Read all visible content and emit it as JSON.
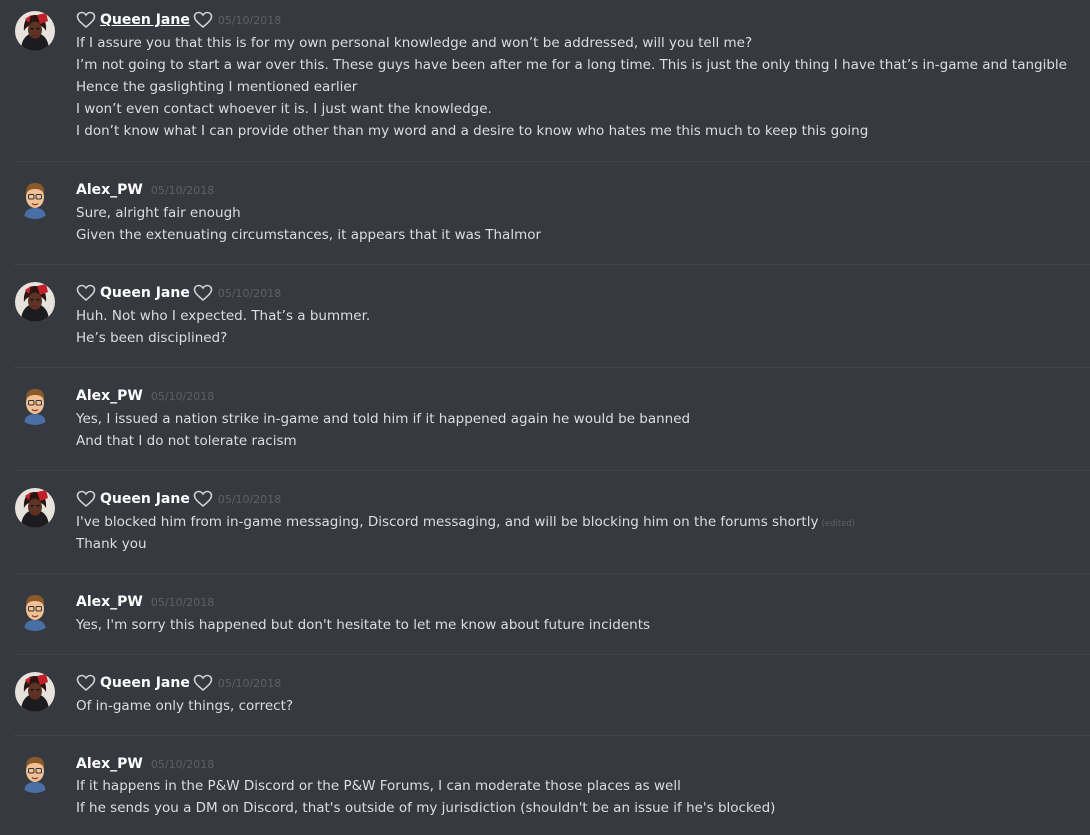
{
  "colors": {
    "background": "#36393f",
    "username": "#ffffff",
    "message_text": "#dcddde",
    "timestamp": "#5e6168",
    "divider": "#40434a"
  },
  "messages": [
    {
      "author": "Queen Jane",
      "hearts": true,
      "underlined": true,
      "avatar_icon": "queen-jane-avatar-icon",
      "timestamp": "05/10/2018",
      "lines": [
        "If I assure you that this is for my own personal knowledge and won’t be addressed, will you tell me?",
        "I’m not going to start a war over this. These guys have been after me for a long time. This is just the only thing I have that’s in-game and tangible",
        "Hence the gaslighting I mentioned earlier",
        "I won’t even contact whoever it is. I just want the knowledge.",
        "I don’t know what I can provide other than my word and a desire to know who hates me this much to keep this going"
      ]
    },
    {
      "author": "Alex_PW",
      "hearts": false,
      "underlined": false,
      "avatar_icon": "alex-avatar-icon",
      "timestamp": "05/10/2018",
      "lines": [
        "Sure, alright fair enough",
        "Given the extenuating circumstances, it appears that it was Thalmor"
      ]
    },
    {
      "author": "Queen Jane",
      "hearts": true,
      "underlined": false,
      "avatar_icon": "queen-jane-avatar-icon",
      "timestamp": "05/10/2018",
      "lines": [
        "Huh. Not who I expected. That’s a bummer.",
        "He’s been disciplined?"
      ]
    },
    {
      "author": "Alex_PW",
      "hearts": false,
      "underlined": false,
      "avatar_icon": "alex-avatar-icon",
      "timestamp": "05/10/2018",
      "lines": [
        "Yes, I issued a nation strike in-game and told him if it happened again he would be banned",
        "And that I do not tolerate racism"
      ]
    },
    {
      "author": "Queen Jane",
      "hearts": true,
      "underlined": false,
      "avatar_icon": "queen-jane-avatar-icon",
      "timestamp": "05/10/2018",
      "lines": [
        "I've blocked him from in-game messaging, Discord messaging, and will be blocking him on the forums shortly",
        "Thank you"
      ],
      "edited_label": "(edited)"
    },
    {
      "author": "Alex_PW",
      "hearts": false,
      "underlined": false,
      "avatar_icon": "alex-avatar-icon",
      "timestamp": "05/10/2018",
      "lines": [
        "Yes, I'm sorry this happened but don't hesitate to let me know about future incidents"
      ]
    },
    {
      "author": "Queen Jane",
      "hearts": true,
      "underlined": false,
      "avatar_icon": "queen-jane-avatar-icon",
      "timestamp": "05/10/2018",
      "lines": [
        "Of in-game only things, correct?"
      ]
    },
    {
      "author": "Alex_PW",
      "hearts": false,
      "underlined": false,
      "avatar_icon": "alex-avatar-icon",
      "timestamp": "05/10/2018",
      "lines": [
        "If it happens in the P&W Discord or the P&W Forums, I can moderate those places as well",
        "If he sends you a DM on Discord, that's outside of my jurisdiction (shouldn't be an issue if he's blocked)"
      ]
    }
  ]
}
